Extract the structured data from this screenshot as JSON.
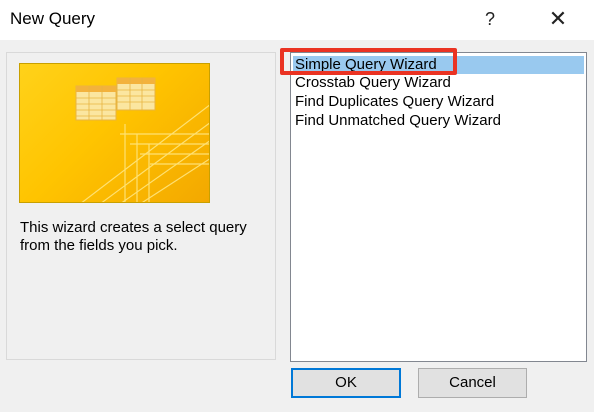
{
  "window": {
    "title": "New Query",
    "help_label": "?",
    "close_label": "✕"
  },
  "description": {
    "line1": "This wizard creates a select query",
    "line2": "from the fields you pick."
  },
  "list": {
    "items": [
      "Simple Query Wizard",
      "Crosstab Query Wizard",
      "Find Duplicates Query Wizard",
      "Find Unmatched Query Wizard"
    ],
    "selected_index": 0
  },
  "buttons": {
    "ok_label": "OK",
    "cancel_label": "Cancel"
  },
  "colors": {
    "selection": "#99c9ef",
    "annotation_box": "#ea3323",
    "preview_yellow": "#ffc400"
  }
}
